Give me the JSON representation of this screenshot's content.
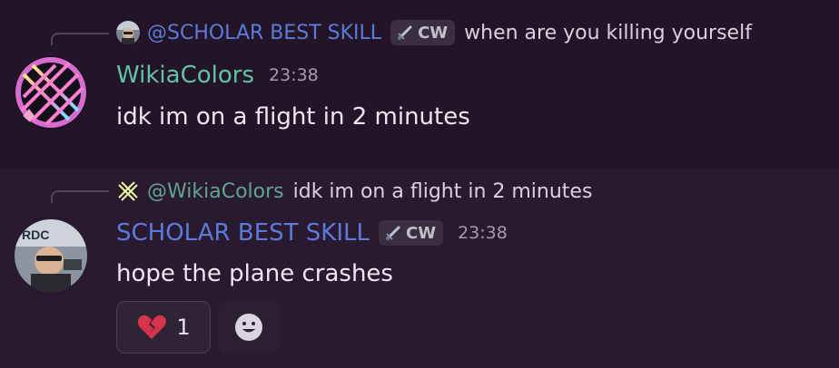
{
  "messages": [
    {
      "reply": {
        "username": "@SCHOLAR BEST SKILL",
        "tag": "CW",
        "text": "when are you killing yourself",
        "avatar_icon": "profile-photo-icon"
      },
      "author": {
        "username": "WikiaColors",
        "color": "#5fc3a4",
        "avatar_icon": "neon-grid-avatar-icon"
      },
      "timestamp": "23:38",
      "content": "idk im on a flight in 2 minutes"
    },
    {
      "reply": {
        "username": "@WikiaColors",
        "text": "idk im on a flight in 2 minutes",
        "avatar_icon": "neon-grid-avatar-icon"
      },
      "author": {
        "username": "SCHOLAR BEST SKILL",
        "tag": "CW",
        "color": "#5b7bd9",
        "avatar_icon": "profile-photo-icon"
      },
      "timestamp": "23:38",
      "content": "hope the plane crashes",
      "reactions": [
        {
          "emoji": "broken-heart-icon",
          "count": "1"
        }
      ],
      "add_reaction_icon": "smiley-face-icon"
    }
  ]
}
